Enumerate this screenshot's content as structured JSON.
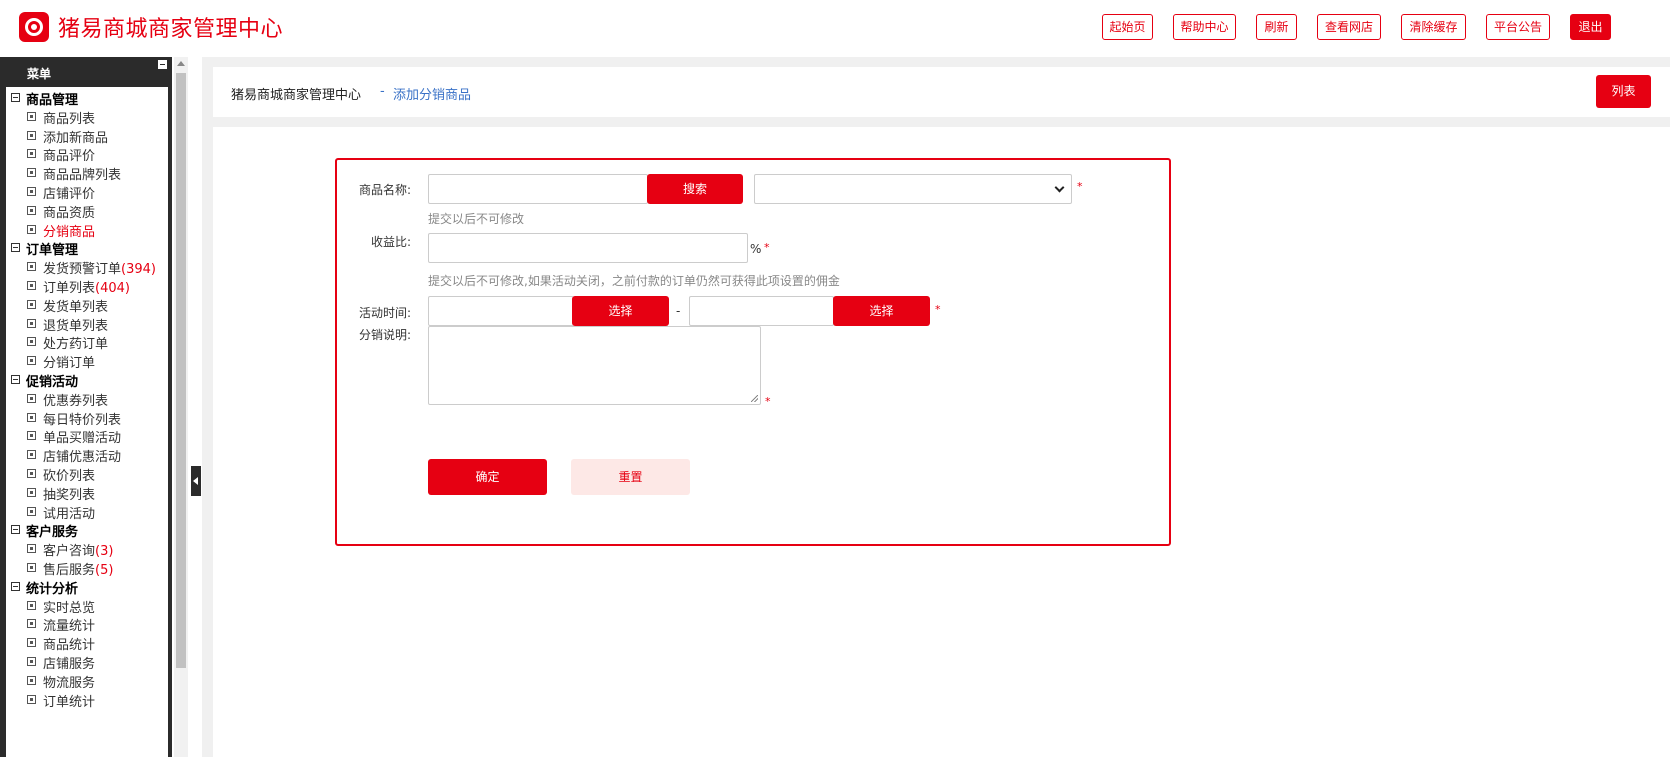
{
  "header": {
    "title": "猪易商城商家管理中心",
    "buttons": [
      "起始页",
      "帮助中心",
      "刷新",
      "查看网店",
      "清除缓存",
      "平台公告",
      "退出"
    ]
  },
  "sidebar": {
    "menu_label": "菜单",
    "groups": [
      {
        "label": "商品管理",
        "items": [
          {
            "label": "商品列表"
          },
          {
            "label": "添加新商品"
          },
          {
            "label": "商品评价"
          },
          {
            "label": "商品品牌列表"
          },
          {
            "label": "店铺评价"
          },
          {
            "label": "商品资质"
          },
          {
            "label": "分销商品",
            "active": true
          }
        ]
      },
      {
        "label": "订单管理",
        "items": [
          {
            "label": "发货预警订单",
            "count": "(394)"
          },
          {
            "label": "订单列表",
            "count": "(404)"
          },
          {
            "label": "发货单列表"
          },
          {
            "label": "退货单列表"
          },
          {
            "label": "处方药订单"
          },
          {
            "label": "分销订单"
          }
        ]
      },
      {
        "label": "促销活动",
        "items": [
          {
            "label": "优惠券列表"
          },
          {
            "label": "每日特价列表"
          },
          {
            "label": "单品买赠活动"
          },
          {
            "label": "店铺优惠活动"
          },
          {
            "label": "砍价列表"
          },
          {
            "label": "抽奖列表"
          },
          {
            "label": "试用活动"
          }
        ]
      },
      {
        "label": "客户服务",
        "items": [
          {
            "label": "客户咨询",
            "count": "(3)"
          },
          {
            "label": "售后服务",
            "count": "(5)"
          }
        ]
      },
      {
        "label": "统计分析",
        "items": [
          {
            "label": "实时总览"
          },
          {
            "label": "流量统计"
          },
          {
            "label": "商品统计"
          },
          {
            "label": "店铺服务"
          },
          {
            "label": "物流服务"
          },
          {
            "label": "订单统计"
          }
        ]
      }
    ]
  },
  "breadcrumb": {
    "main": "猪易商城商家管理中心",
    "separator": "-",
    "current": "添加分销商品",
    "list_button": "列表"
  },
  "form": {
    "product_name_label": "商品名称:",
    "search_button": "搜索",
    "required_mark": "*",
    "product_hint": "提交以后不可修改",
    "ratio_label": "收益比:",
    "ratio_unit": "%",
    "ratio_hint": "提交以后不可修改,如果活动关闭，之前付款的订单仍然可获得此项设置的佣金",
    "time_label": "活动时间:",
    "select_button": "选择",
    "time_separator": "-",
    "desc_label": "分销说明:",
    "confirm_button": "确定",
    "reset_button": "重置"
  },
  "colors": {
    "brand": "#e60012",
    "link": "#3a72c7"
  }
}
